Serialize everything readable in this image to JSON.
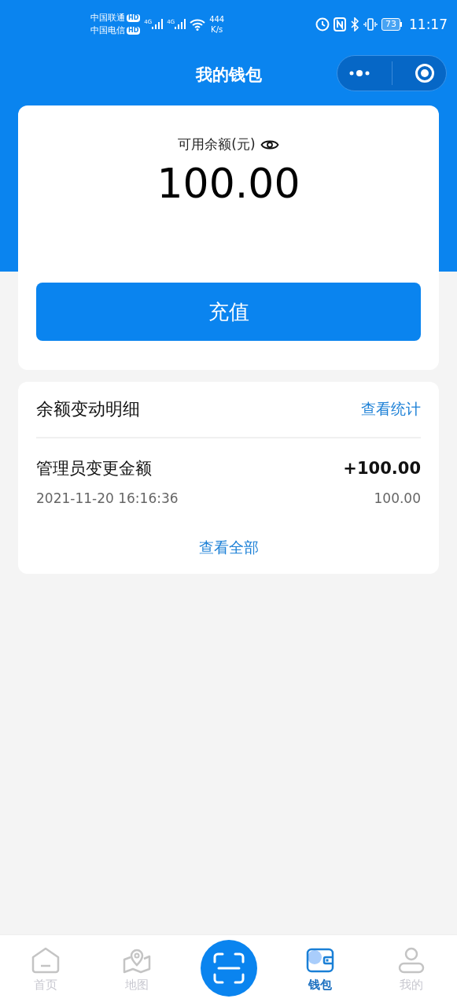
{
  "status_bar": {
    "carriers": [
      {
        "name": "中国联通",
        "badge": "HD"
      },
      {
        "name": "中国电信",
        "badge": "HD"
      }
    ],
    "networks": [
      "4G",
      "4G"
    ],
    "speed": "444",
    "speed_unit": "K/s",
    "battery": "73",
    "time": "11:17"
  },
  "title": "我的钱包",
  "balance": {
    "label": "可用余额(元)",
    "amount": "100.00",
    "button": "充值"
  },
  "history": {
    "title": "余额变动明细",
    "link": "查看统计",
    "items": [
      {
        "name": "管理员变更金额",
        "change": "+100.00",
        "time": "2021-11-20 16:16:36",
        "balance": "100.00"
      }
    ],
    "more": "查看全部"
  },
  "tabs": [
    {
      "kind": "home",
      "label": "首页",
      "selected": false
    },
    {
      "kind": "map",
      "label": "地图",
      "selected": false
    },
    {
      "kind": "scan",
      "selected": false
    },
    {
      "kind": "wallet",
      "label": "钱包",
      "selected": true
    },
    {
      "kind": "user",
      "label": "我的",
      "selected": false
    }
  ]
}
